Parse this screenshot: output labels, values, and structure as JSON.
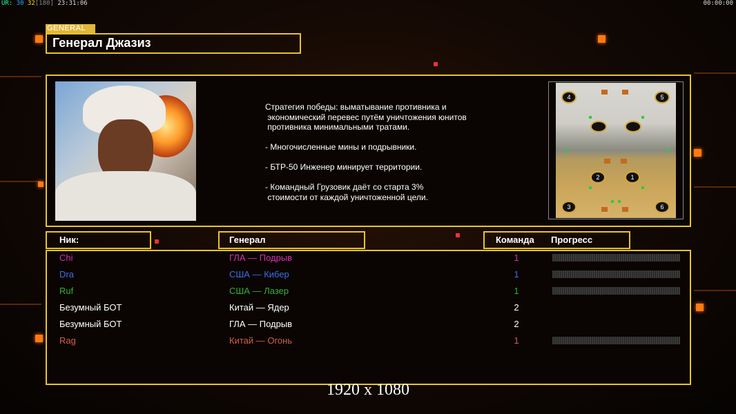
{
  "hud": {
    "ur_label": "UR:",
    "val1": "30",
    "val2": "32",
    "val3": "[180]",
    "clock": "23:31:06",
    "timer": "00:00:00"
  },
  "general": {
    "tag": "GENERAL",
    "name": "Генерал Джазиз",
    "strategy": "Стратегия победы: выматывание противника и\n экономический перевес путём уничтожения юнитов\n противника минимальными тратами.\n\n- Многочисленные мины и подрывники.\n\n- БТР-50 Инженер минирует территории.\n\n- Командный Грузовик даёт со старта 3%\n стоимости от каждой уничтоженной цели."
  },
  "minimap": {
    "badges": [
      "4",
      "5",
      "2",
      "1",
      "3",
      "6"
    ]
  },
  "table": {
    "headers": {
      "nick": "Ник:",
      "general": "Генерал",
      "team": "Команда",
      "progress": "Прогресс"
    },
    "rows": [
      {
        "nick": "Chi",
        "general": "ГЛА — Подрыв",
        "team": "1",
        "color": "#d62fb0",
        "team_color": "#d62fb0",
        "has_progress": true
      },
      {
        "nick": "Dra",
        "general": "США — Кибер",
        "team": "1",
        "color": "#3b6ee8",
        "team_color": "#3b6ee8",
        "has_progress": true
      },
      {
        "nick": "Ruf",
        "general": "США — Лазер",
        "team": "1",
        "color": "#33b233",
        "team_color": "#33b233",
        "has_progress": true
      },
      {
        "nick": "Безумный БОТ",
        "general": "Китай — Ядер",
        "team": "2",
        "color": "#ffffff",
        "team_color": "#ffffff",
        "has_progress": false
      },
      {
        "nick": "Безумный БОТ",
        "general": "ГЛА — Подрыв",
        "team": "2",
        "color": "#ffffff",
        "team_color": "#ffffff",
        "has_progress": false
      },
      {
        "nick": "Rag",
        "general": "Китай — Огонь",
        "team": "1",
        "color": "#d2604c",
        "team_color": "#d2604c",
        "has_progress": true
      }
    ]
  },
  "resolution": "1920 x 1080",
  "colors": {
    "border": "#e9c326",
    "accent": "#ff7a12"
  }
}
